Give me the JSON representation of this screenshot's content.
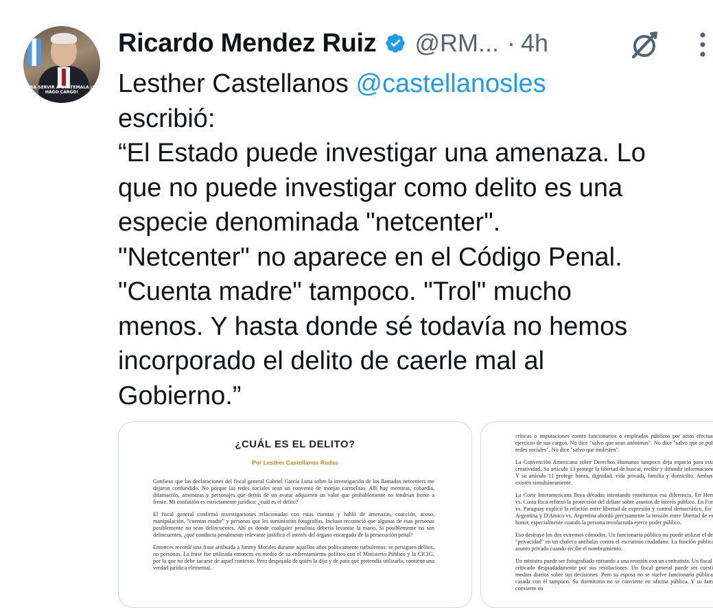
{
  "tweet": {
    "author_name": "Ricardo Mendez Ruiz",
    "handle": "@RM...",
    "separator": "·",
    "time": "4h",
    "avatar_caption": "PARA SERVIR A GUATEMALA ¡ME HAGO CARGO!",
    "text_lines": [
      "Lesther Castellanos ",
      "escribió:",
      "“El Estado puede investigar una amenaza. Lo",
      "que no puede investigar como delito es una",
      "especie denominada \"netcenter\".",
      "\"Netcenter\" no aparece en el Código Penal.",
      "\"Cuenta madre\" tampoco. \"Trol\" mucho",
      "menos. Y hasta donde sé todavía no hemos",
      "incorporado el delito de caerle mal al",
      "Gobierno.”"
    ],
    "mention": "@castellanosles",
    "icons": {
      "verified": "verified-badge-icon",
      "grok": "grok-icon",
      "more": "more-options-icon"
    },
    "accent_color": "#1d9bf0"
  },
  "attachments": {
    "doc1": {
      "title": "¿CUÁL ES EL DELITO?",
      "author": "Por Lesther Castellanos Rodas",
      "paragraphs": [
        "Confieso que las declaraciones del fiscal general Gabriel García Luna sobre la investigación de los llamados netcenters me dejaron confundido. No porque las redes sociales sean un convento de monjas carmelitas. Allí hay mentiras, cobardía, difamación, amenazas y personajes que detrás de un avatar adquieren un valor que probablemente no tendrían frente a frente. Mi confusión es estrictamente jurídica: ¿cuál es el delito?",
        "El fiscal general confirmó investigaciones relacionadas con estas cuentas y habló de amenazas, coacción, acoso, manipulación, “cuentas madre” y personas que les suministran fotografías. Incluso reconoció que algunas de esas personas posiblemente no sean delincuentes. Ahí es donde cualquier penalista debería levantar la mano. Si posiblemente no son delincuentes, ¿qué conducta penalmente relevante justifica el interés del órgano encargado de la persecución penal?",
        "Entonces recordé una frase atribuida a Jimmy Morales durante aquellos años políticamente turbulentos: se persiguen delitos, no personas. La frase fue utilizada entonces en medio de su enfrentamiento político con el Ministerio Público y la CICIG, por lo que no debe sacarse de aquel contexto. Pero despojada de quién la dijo y de para qué pretendía utilizarla, contiene una verdad jurídica elemental."
      ]
    },
    "doc2": {
      "paragraphs": [
        "críticas o imputaciones contra funcionarios o empleados públicos por actos efectuados en el ejercicio de sus cargos. No dice \"salvo que sean anónimas\". No dice \"salvo que se publiquen en redes sociales\". No dice \"salvo que molesten\".",
        "La Convención Americana sobre Derechos Humanos tampoco deja espacio para esta clase de creatividad. Su artículo 13 protege la libertad de buscar, recibir y difundir informaciones e ideas. Y su artículo 11 protege honra, dignidad, vida privada, familia y domicilio. Ambos derechos existen simultáneamente.",
        "La Corte Interamericana lleva décadas intentando enseñarnos esa diferencia. En Herrera Ulloa vs. Costa Rica reforzó la protección del debate sobre asuntos de interés público. En Fontevecchia vs. Paraguay explicó la relación entre libertad de expresión y control democrático. En Kimel vs. Argentina y D'Amico vs. Argentina abordó precisamente la tensión entre libertad de expresión y honor, especialmente cuando la persona involucrada ejerce poder público.",
        "Eso destruye los dos extremos cómodos. Un funcionario público no puede utilizar el derecho a la \"privacidad\" en un chaleco antibalas contra el escrutinio ciudadano. La función pública no es un asunto privado cuando recibe el nombramiento.",
        "Un ministro puede ser fotografiado entrando a una reunión con un contratista. Un fiscal puede ser criticado despiadadamente por sus resoluciones. Un fiscal general puede ser cuestionado en medios diarios sobre sus decisiones. Pero su esposa no se vuelve funcionaria pública por estar casada con él tampoco. Su dormitorio no se convierte en oficina pública. Y su familia no se convierte en"
      ]
    }
  }
}
